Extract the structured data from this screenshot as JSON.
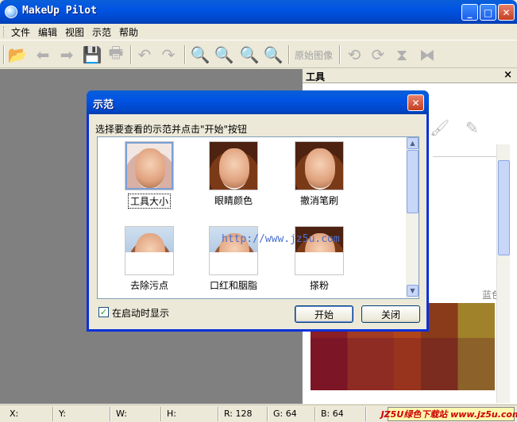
{
  "window": {
    "title": "MakeUp Pilot",
    "min": "_",
    "max": "□",
    "close": "✕"
  },
  "menu": [
    "文件",
    "编辑",
    "视图",
    "示范",
    "帮助"
  ],
  "toolbar": {
    "original_image": "原始图像"
  },
  "panel": {
    "title": "工具",
    "close": "×",
    "blue_label": "蓝色"
  },
  "dialog": {
    "title": "示范",
    "close": "✕",
    "instruction": "选择要查看的示范并点击\"开始\"按钮",
    "items": [
      {
        "label": "工具大小"
      },
      {
        "label": "眼睛颜色"
      },
      {
        "label": "撤消笔刷"
      },
      {
        "label": "去除污点"
      },
      {
        "label": "口红和胭脂"
      },
      {
        "label": "搽粉"
      }
    ],
    "show_on_startup": "在启动时显示",
    "start": "开始",
    "close_button": "关闭"
  },
  "watermark": "http://www.jz5u.com",
  "status": {
    "x": "X:",
    "y": "Y:",
    "w": "W:",
    "h": "H:",
    "r": "R: 128",
    "g": "G: 64",
    "b": "B: 64",
    "badge": "JZ5U绿色下载站 www.jz5u.com"
  }
}
